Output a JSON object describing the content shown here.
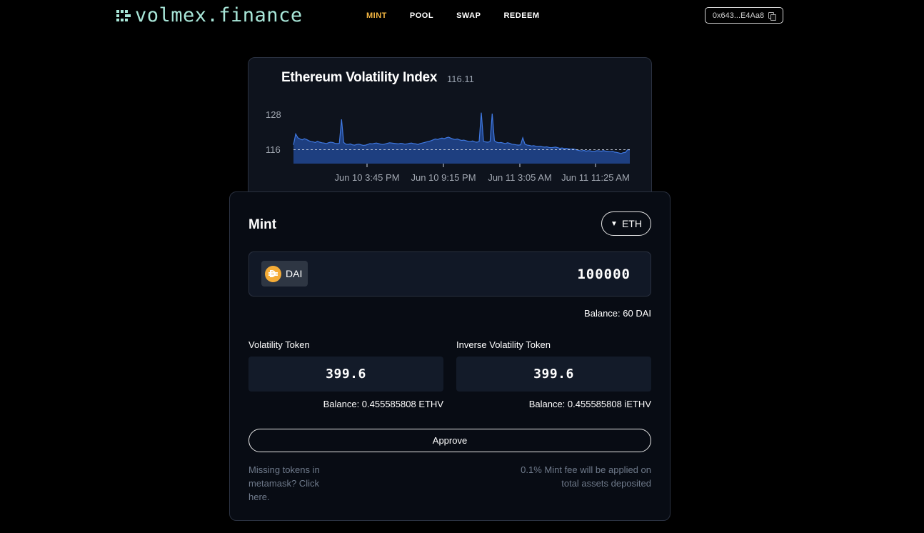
{
  "header": {
    "logo_text": "volmex.finance",
    "nav": [
      "MINT",
      "POOL",
      "SWAP",
      "REDEEM"
    ],
    "active_nav": "MINT",
    "wallet_address": "0x643...E4Aa8",
    "accent_color": "#f5b642"
  },
  "chart": {
    "title": "Ethereum Volatility Index",
    "current_value": "116.11",
    "y_ticks": [
      "128",
      "116"
    ],
    "x_ticks": [
      "Jun 10 3:45 PM",
      "Jun 10 9:15 PM",
      "Jun 11 3:05 AM",
      "Jun 11 11:25 AM"
    ]
  },
  "chart_data": {
    "type": "area",
    "title": "Ethereum Volatility Index",
    "ylim": [
      108,
      130
    ],
    "x_ticks": [
      "Jun 10 3:45 PM",
      "Jun 10 9:15 PM",
      "Jun 11 3:05 AM",
      "Jun 11 11:25 AM"
    ],
    "y_ticks": [
      128,
      116
    ],
    "reference_line": 116.11,
    "values": [
      117.8,
      121.5,
      120.2,
      119.8,
      119.5,
      119.9,
      119.6,
      119.2,
      118.9,
      118.8,
      118.6,
      119.0,
      118.7,
      118.5,
      118.4,
      118.2,
      118.5,
      118.7,
      118.6,
      118.3,
      118.2,
      118.3,
      126.5,
      118.6,
      118.0,
      117.9,
      118.1,
      117.8,
      117.7,
      117.9,
      118.0,
      117.8,
      117.6,
      117.7,
      117.9,
      118.2,
      118.1,
      118.3,
      118.4,
      118.2,
      118.0,
      117.9,
      118.1,
      118.3,
      118.5,
      118.4,
      118.3,
      118.2,
      118.1,
      118.3,
      118.2,
      118.0,
      118.1,
      118.3,
      118.4,
      118.2,
      118.1,
      117.9,
      118.2,
      118.4,
      118.6,
      118.8,
      119.0,
      119.2,
      119.5,
      119.8,
      119.6,
      119.9,
      120.1,
      119.9,
      120.2,
      120.4,
      120.1,
      119.8,
      119.6,
      119.8,
      119.5,
      119.3,
      119.4,
      119.2,
      119.0,
      118.9,
      119.1,
      118.8,
      118.7,
      118.9,
      128.8,
      119.0,
      118.8,
      118.7,
      118.9,
      128.5,
      119.2,
      118.7,
      118.5,
      118.6,
      118.4,
      118.2,
      118.5,
      118.3,
      118.0,
      117.9,
      117.8,
      117.7,
      117.8,
      120.2,
      118.0,
      117.7,
      117.6,
      117.4,
      117.5,
      117.3,
      117.2,
      117.3,
      117.1,
      117.0,
      117.1,
      116.9,
      116.8,
      116.9,
      117.0,
      116.8,
      116.6,
      116.7,
      116.5,
      116.6,
      116.4,
      116.3,
      116.4,
      116.2,
      116.0,
      115.8,
      115.7,
      115.9,
      115.6,
      115.8,
      115.7,
      115.5,
      115.6,
      115.8,
      115.7,
      115.6,
      115.8,
      115.6,
      115.5,
      115.4,
      115.6,
      115.3,
      115.2,
      115.0,
      114.8,
      115.1,
      115.2,
      116.1,
      116.11
    ]
  },
  "mint": {
    "title": "Mint",
    "collateral_select": "ETH",
    "deposit": {
      "token": "DAI",
      "amount": "100000",
      "balance": "Balance: 60 DAI"
    },
    "volatility": {
      "label": "Volatility Token",
      "value": "399.6",
      "balance": "Balance: 0.455585808 ETHV"
    },
    "inverse": {
      "label": "Inverse Volatility Token",
      "value": "399.6",
      "balance": "Balance: 0.455585808 iETHV"
    },
    "approve_label": "Approve",
    "missing_tokens": "Missing tokens in metamask? Click here.",
    "fee_note": "0.1% Mint fee will be applied on total assets deposited"
  }
}
